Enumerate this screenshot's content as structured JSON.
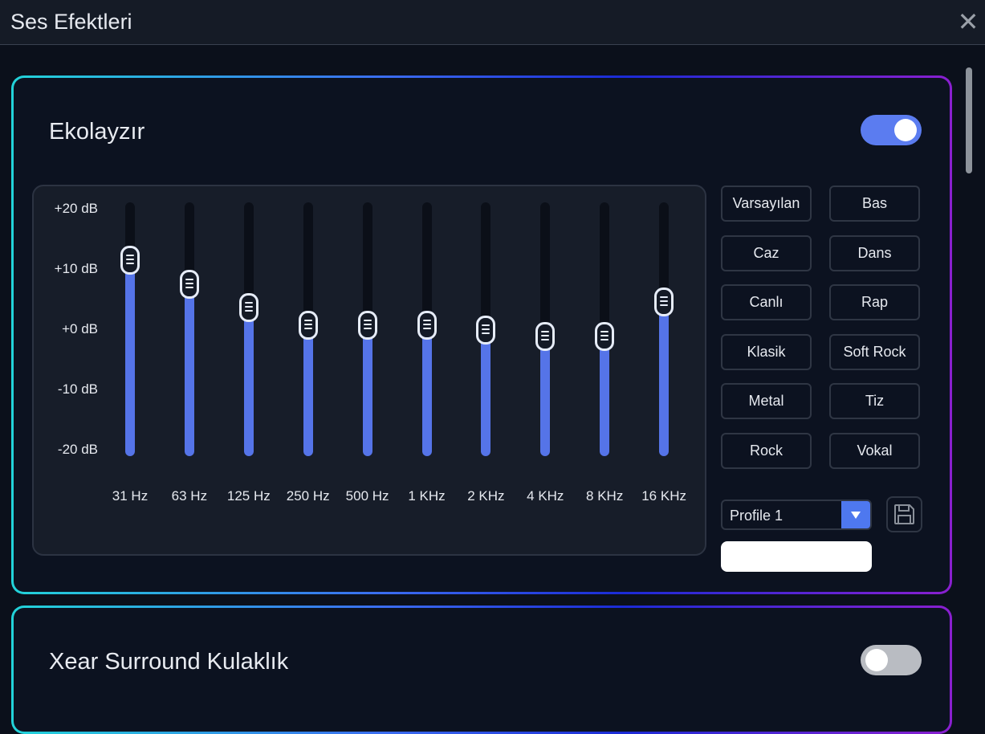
{
  "window": {
    "title": "Ses Efektleri",
    "close_icon": "close-icon"
  },
  "equalizer": {
    "title": "Ekolayzır",
    "enabled": true,
    "db_labels": [
      "+20 dB",
      "+10 dB",
      "+0 dB",
      "-10 dB",
      "-20 dB"
    ],
    "db_range": [
      -20,
      20
    ],
    "bands": [
      {
        "freq": "31 Hz",
        "gain_db": 10.4
      },
      {
        "freq": "63 Hz",
        "gain_db": 6.6
      },
      {
        "freq": "125 Hz",
        "gain_db": 2.9
      },
      {
        "freq": "250 Hz",
        "gain_db": 0.1
      },
      {
        "freq": "500 Hz",
        "gain_db": 0.1
      },
      {
        "freq": "1 KHz",
        "gain_db": 0.1
      },
      {
        "freq": "2 KHz",
        "gain_db": -0.6
      },
      {
        "freq": "4 KHz",
        "gain_db": -1.7
      },
      {
        "freq": "8 KHz",
        "gain_db": -1.7
      },
      {
        "freq": "16 KHz",
        "gain_db": 3.8
      }
    ],
    "presets": [
      "Varsayılan",
      "Bas",
      "Caz",
      "Dans",
      "Canlı",
      "Rap",
      "Klasik",
      "Soft Rock",
      "Metal",
      "Tiz",
      "Rock",
      "Vokal"
    ],
    "profile": {
      "selected": "Profile 1"
    },
    "profile_name_value": "",
    "save_icon": "save-icon"
  },
  "surround": {
    "title": "Xear Surround Kulaklık",
    "enabled": false
  },
  "colors": {
    "accent": "#5574e8",
    "toggle_on": "#5b7cf0",
    "toggle_off": "#b9bcc2",
    "border_gradient": [
      "#22d3d9",
      "#1b2bd6",
      "#8a1fd0"
    ]
  }
}
